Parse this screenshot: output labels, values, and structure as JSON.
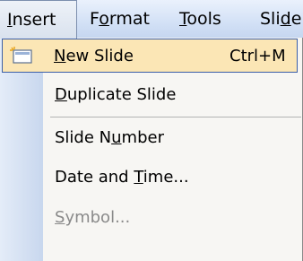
{
  "menubar": {
    "insert": {
      "pre": "",
      "mn": "I",
      "post": "nsert"
    },
    "format": {
      "pre": "F",
      "mn": "o",
      "post": "rmat"
    },
    "tools": {
      "pre": "",
      "mn": "T",
      "post": "ools"
    },
    "slide": {
      "pre": "Sli",
      "mn": "d",
      "post": "e"
    }
  },
  "menu": {
    "new_slide": {
      "pre": "",
      "mn": "N",
      "post": "ew Slide",
      "shortcut": "Ctrl+M",
      "icon": "new-slide-icon"
    },
    "duplicate_slide": {
      "pre": "",
      "mn": "D",
      "post": "uplicate Slide"
    },
    "slide_number": {
      "pre": "Slide N",
      "mn": "u",
      "post": "mber"
    },
    "date_time": {
      "pre": "Date and ",
      "mn": "T",
      "post": "ime..."
    },
    "symbol": {
      "pre": "",
      "mn": "S",
      "post": "ymbol...",
      "disabled": true
    }
  },
  "colors": {
    "highlight": "#fbe6b5",
    "highlight_border": "#3c5fa8",
    "disabled_text": "#8a8a8a"
  }
}
